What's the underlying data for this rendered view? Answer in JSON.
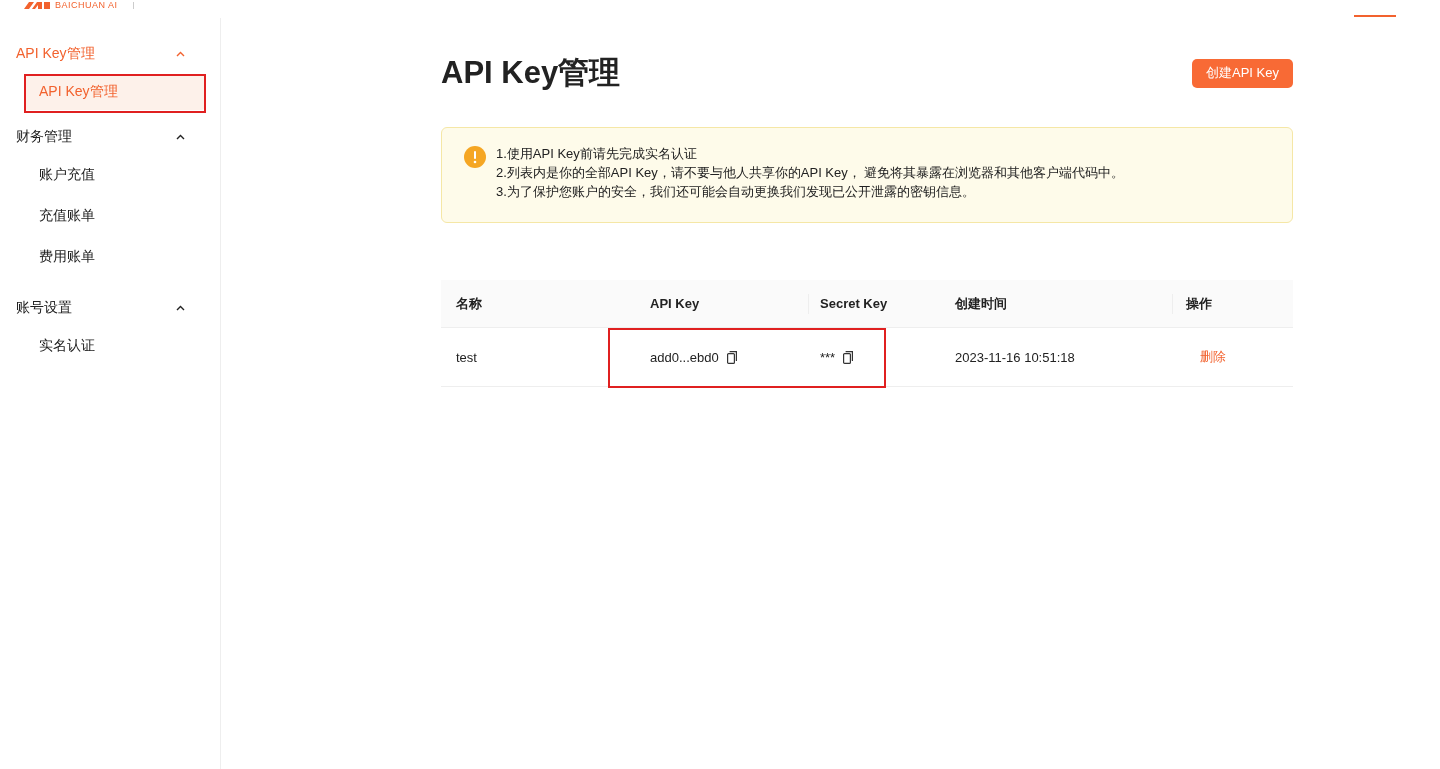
{
  "header": {
    "logo_text": "BAICHUAN AI",
    "nav_indicator": true
  },
  "sidebar": {
    "groups": [
      {
        "label": "API Key管理",
        "expanded": true,
        "active": true,
        "items": [
          {
            "label": "API Key管理",
            "selected": true,
            "highlighted": true
          }
        ]
      },
      {
        "label": "财务管理",
        "expanded": true,
        "active": false,
        "items": [
          {
            "label": "账户充值",
            "selected": false,
            "highlighted": false
          },
          {
            "label": "充值账单",
            "selected": false,
            "highlighted": false
          },
          {
            "label": "费用账单",
            "selected": false,
            "highlighted": false
          }
        ]
      },
      {
        "label": "账号设置",
        "expanded": true,
        "active": false,
        "items": [
          {
            "label": "实名认证",
            "selected": false,
            "highlighted": false
          }
        ]
      }
    ]
  },
  "page": {
    "title": "API Key管理",
    "create_button": "创建API Key"
  },
  "notice": {
    "lines": [
      "1.使用API Key前请先完成实名认证",
      "2.列表内是你的全部API Key，请不要与他人共享你的API Key， 避免将其暴露在浏览器和其他客户端代码中。",
      "3.为了保护您账户的安全，我们还可能会自动更换我们发现已公开泄露的密钥信息。"
    ]
  },
  "table": {
    "columns": [
      "名称",
      "API Key",
      "Secret Key",
      "创建时间",
      "操作"
    ],
    "rows": [
      {
        "name": "test",
        "api_key": "add0...ebd0",
        "secret_key": "***",
        "created": "2023-11-16 10:51:18",
        "action": "删除",
        "keys_highlighted": true
      }
    ]
  }
}
